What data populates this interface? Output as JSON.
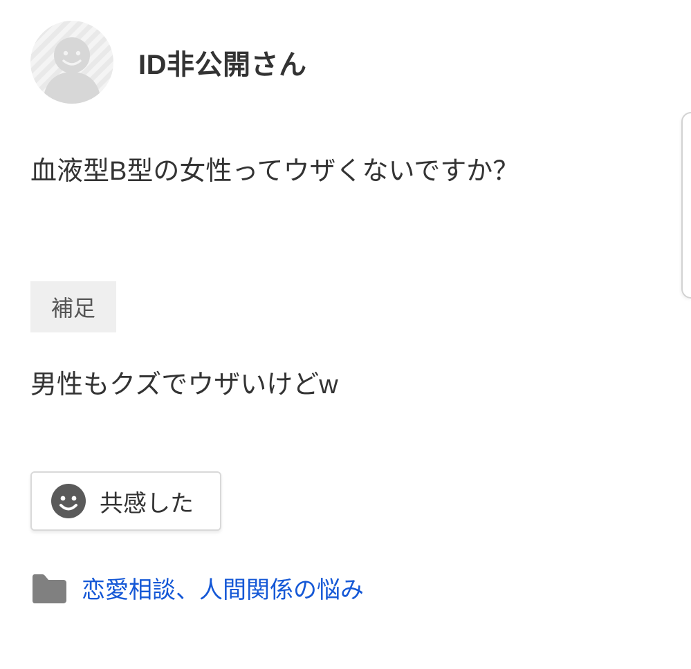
{
  "user": {
    "name": "ID非公開さん"
  },
  "question": {
    "body": "血液型B型の女性ってウザくないですか？"
  },
  "supplement": {
    "label": "補足",
    "body": "男性もクズでウザいけどw"
  },
  "actions": {
    "like_label": "共感した"
  },
  "category": {
    "link_text": "恋愛相談、人間関係の悩み"
  }
}
